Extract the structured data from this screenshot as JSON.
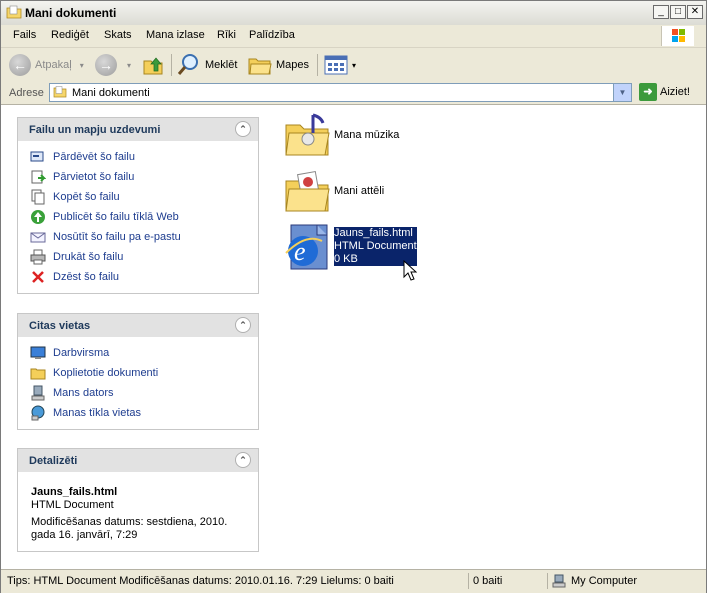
{
  "window": {
    "title": "Mani dokumenti",
    "minimize": "_",
    "maximize": "□",
    "close": "✕"
  },
  "menu": [
    "Fails",
    "Rediģēt",
    "Skats",
    "Mana izlase",
    "Rīki",
    "Palīdzība"
  ],
  "toolbar": {
    "back_label": "Atpakaļ",
    "search_label": "Meklēt",
    "folders_label": "Mapes"
  },
  "address": {
    "label": "Adrese",
    "value": "Mani dokumenti",
    "go_label": "Aiziet!"
  },
  "tasks_panel": {
    "title": "Failu un mapju uzdevumi",
    "items": [
      {
        "label": "Pārdēvēt šo failu",
        "icon": "rename-icon"
      },
      {
        "label": "Pārvietot šo failu",
        "icon": "move-icon"
      },
      {
        "label": "Kopēt šo failu",
        "icon": "copy-icon"
      },
      {
        "label": "Publicēt šo failu tīklā Web",
        "icon": "publish-web-icon"
      },
      {
        "label": "Nosūtīt šo failu pa e-pastu",
        "icon": "email-icon"
      },
      {
        "label": "Drukāt šo failu",
        "icon": "print-icon"
      },
      {
        "label": "Dzēst šo failu",
        "icon": "delete-icon"
      }
    ]
  },
  "places_panel": {
    "title": "Citas vietas",
    "items": [
      {
        "label": "Darbvirsma",
        "icon": "desktop-icon"
      },
      {
        "label": "Koplietotie dokumenti",
        "icon": "shared-folder-icon"
      },
      {
        "label": "Mans dators",
        "icon": "computer-icon"
      },
      {
        "label": "Manas tīkla vietas",
        "icon": "network-icon"
      }
    ]
  },
  "details_panel": {
    "title": "Detalizēti",
    "name": "Jauns_fails.html",
    "type": "HTML Document",
    "modified": "Modificēšanas datums: sestdiena, 2010. gada 16. janvārī, 7:29"
  },
  "files": [
    {
      "name": "Mana mūzika",
      "icon": "music-folder-icon"
    },
    {
      "name": "Mani attēli",
      "icon": "pictures-folder-icon"
    },
    {
      "name": "Jauns_fails.html",
      "type": "HTML Document",
      "size": "0 KB",
      "icon": "ie-document-icon",
      "selected": true
    }
  ],
  "status": {
    "tip": "Tips: HTML Document Modificēšanas datums: 2010.01.16. 7:29 Lielums: 0 baiti",
    "size": "0 baiti",
    "zone": "My Computer"
  }
}
